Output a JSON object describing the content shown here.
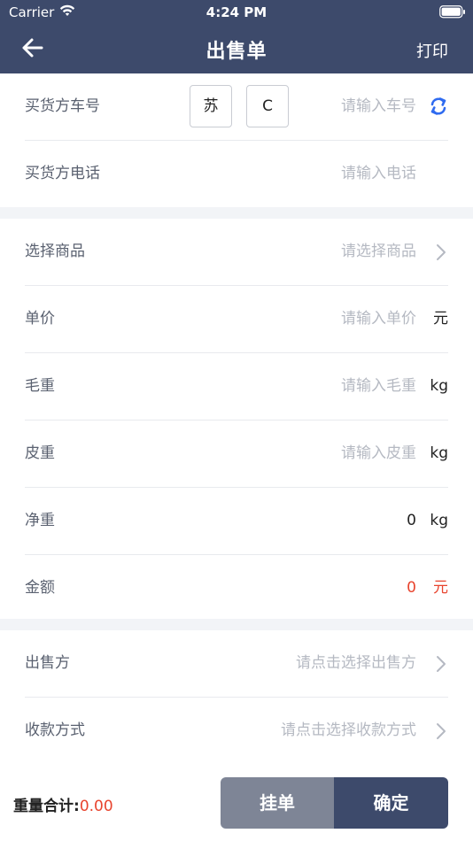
{
  "status_bar": {
    "carrier": "Carrier",
    "time": "4:24 PM"
  },
  "nav": {
    "title": "出售单",
    "print_label": "打印",
    "back_icon": "arrow-left-icon"
  },
  "buyer": {
    "plate_label": "买货方车号",
    "plate_province": "苏",
    "plate_letter": "C",
    "plate_placeholder": "请输入车号",
    "phone_label": "买货方电话",
    "phone_placeholder": "请输入电话"
  },
  "goods": {
    "product_label": "选择商品",
    "product_placeholder": "请选择商品",
    "price_label": "单价",
    "price_placeholder": "请输入单价",
    "price_unit": "元",
    "gross_label": "毛重",
    "gross_placeholder": "请输入毛重",
    "gross_unit": "kg",
    "tare_label": "皮重",
    "tare_placeholder": "请输入皮重",
    "tare_unit": "kg",
    "net_label": "净重",
    "net_value": "0",
    "net_unit": "kg",
    "amount_label": "金额",
    "amount_value": "0",
    "amount_unit": "元"
  },
  "seller": {
    "seller_label": "出售方",
    "seller_placeholder": "请点击选择出售方",
    "payment_label": "收款方式",
    "payment_placeholder": "请点击选择收款方式"
  },
  "footer": {
    "total_label": "重量合计:",
    "total_value": "0.00",
    "hold_label": "挂单",
    "confirm_label": "确定"
  },
  "colors": {
    "header_bg": "#3d4a6b",
    "accent_red": "#e8442e",
    "refresh_blue": "#2f6bf0",
    "hold_button_bg": "#7e8596"
  }
}
